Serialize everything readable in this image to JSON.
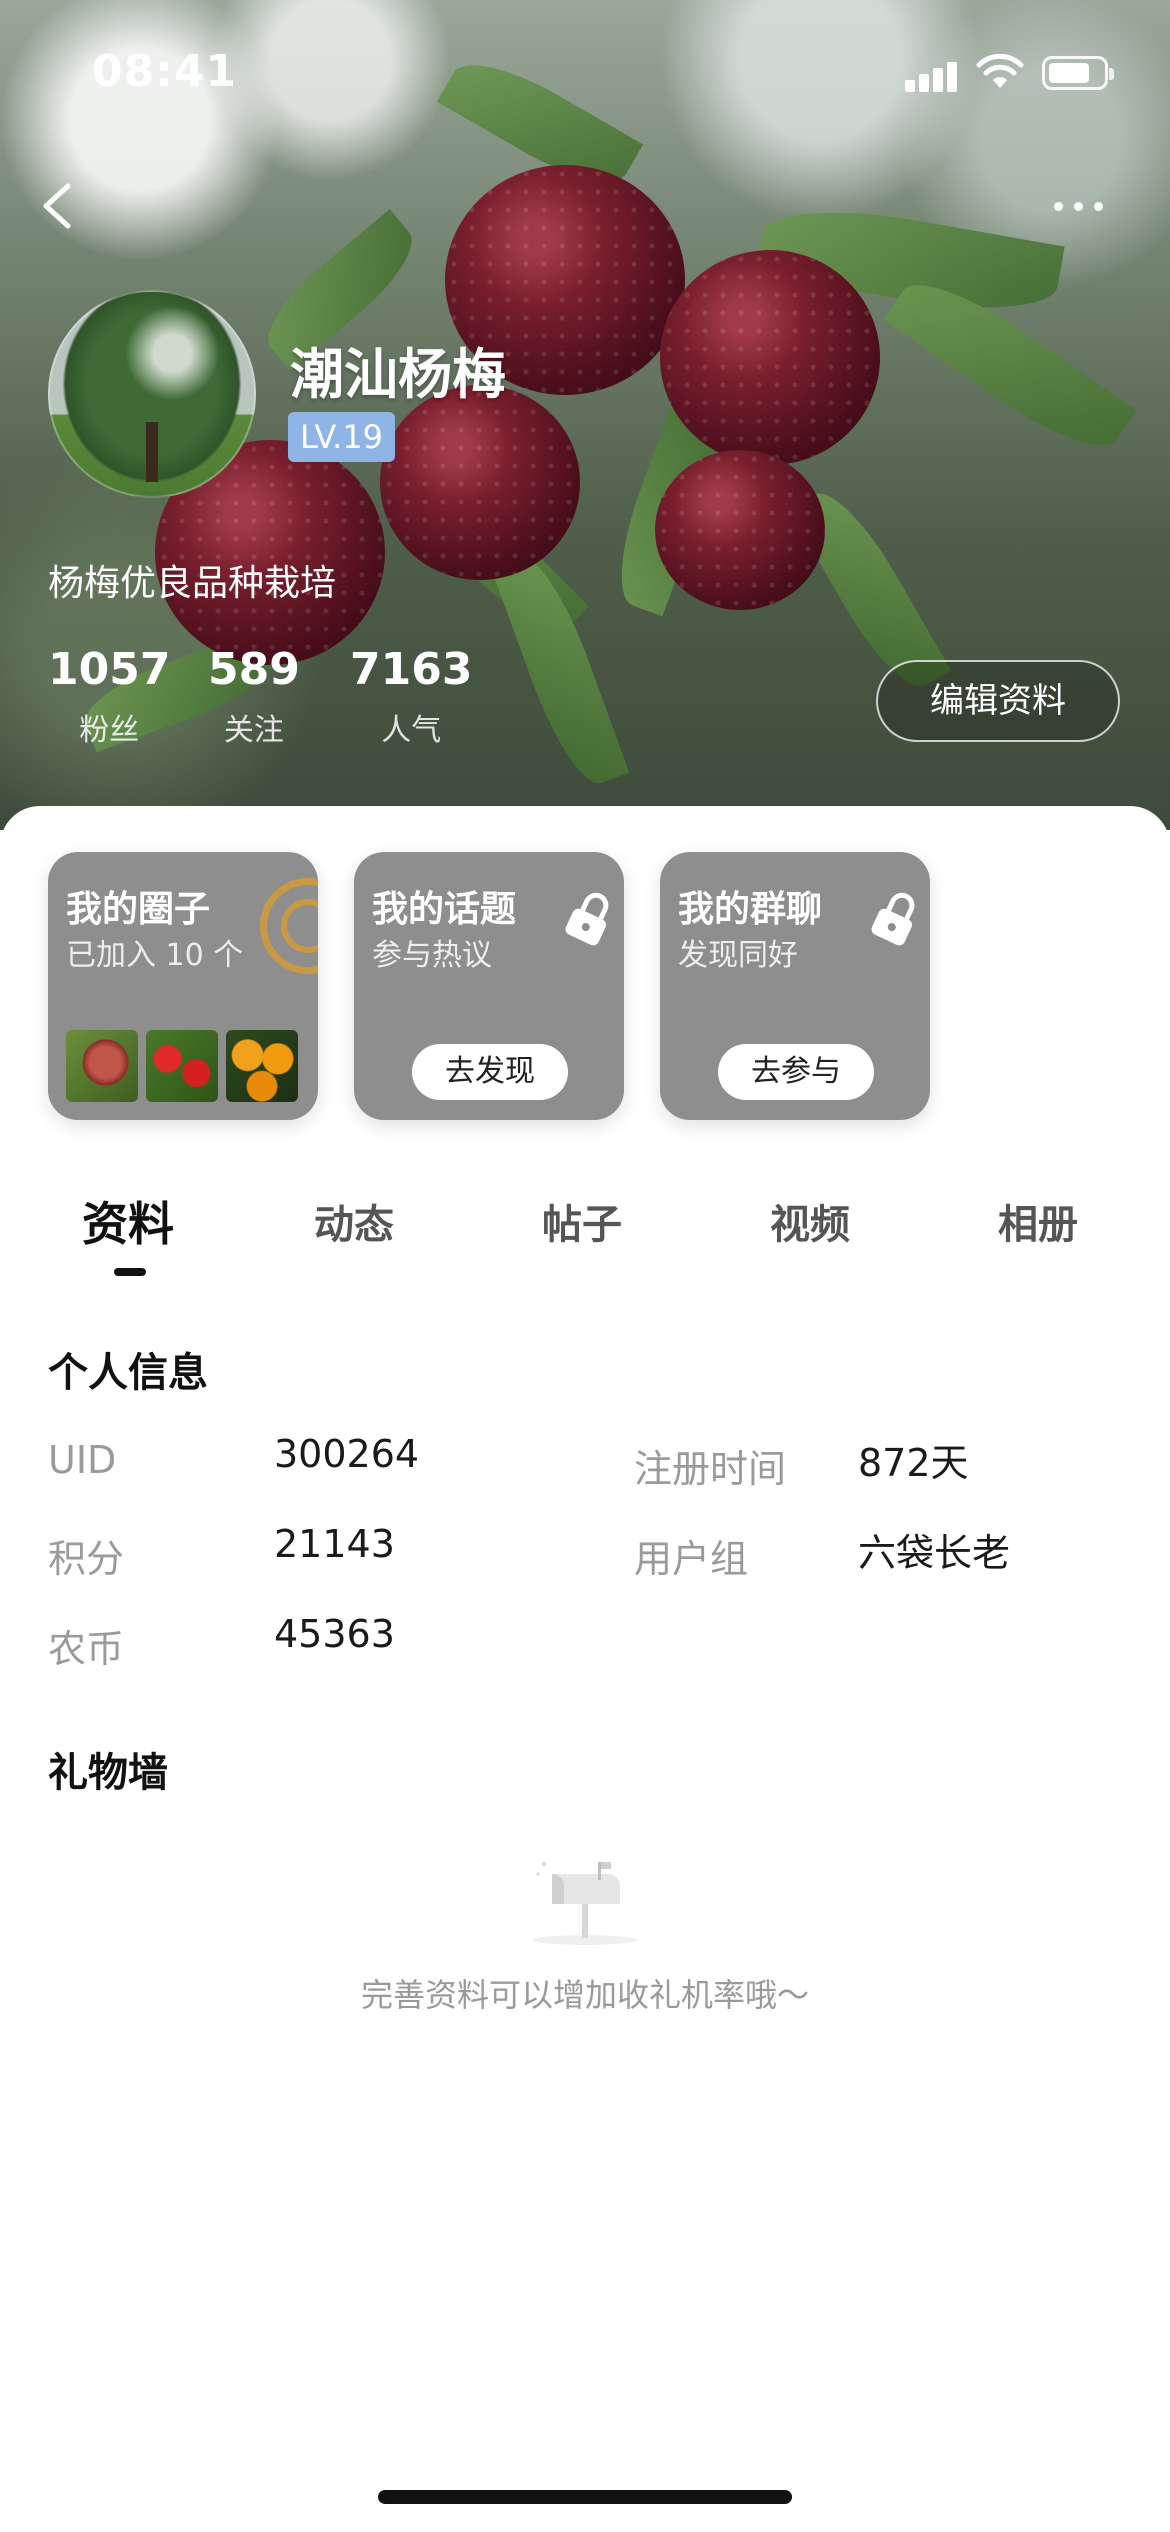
{
  "status_bar": {
    "time": "08:41"
  },
  "profile": {
    "name": "潮汕杨梅",
    "level": "LV.19",
    "bio": "杨梅优良品种栽培",
    "stats": [
      {
        "value": "1057",
        "label": "粉丝"
      },
      {
        "value": "589",
        "label": "关注"
      },
      {
        "value": "7163",
        "label": "人气"
      }
    ],
    "edit_button": "编辑资料"
  },
  "cards": [
    {
      "title": "我的圈子",
      "subtitle": "已加入 10 个"
    },
    {
      "title": "我的话题",
      "subtitle": "参与热议",
      "button": "去发现"
    },
    {
      "title": "我的群聊",
      "subtitle": "发现同好",
      "button": "去参与"
    }
  ],
  "tabs": [
    "资料",
    "动态",
    "帖子",
    "视频",
    "相册"
  ],
  "active_tab": "资料",
  "personal_info": {
    "title": "个人信息",
    "fields": [
      {
        "label": "UID",
        "value": "300264"
      },
      {
        "label": "注册时间",
        "value": "872天"
      },
      {
        "label": "积分",
        "value": "21143"
      },
      {
        "label": "用户组",
        "value": "六袋长老"
      },
      {
        "label": "农币",
        "value": "45363"
      }
    ]
  },
  "gift_wall": {
    "title": "礼物墙",
    "empty_text": "完善资料可以增加收礼机率哦～"
  },
  "colors": {
    "level_badge": "#8fb4e6",
    "card_bg": "#8e8e8e",
    "ring_accent": "#c99a44"
  }
}
